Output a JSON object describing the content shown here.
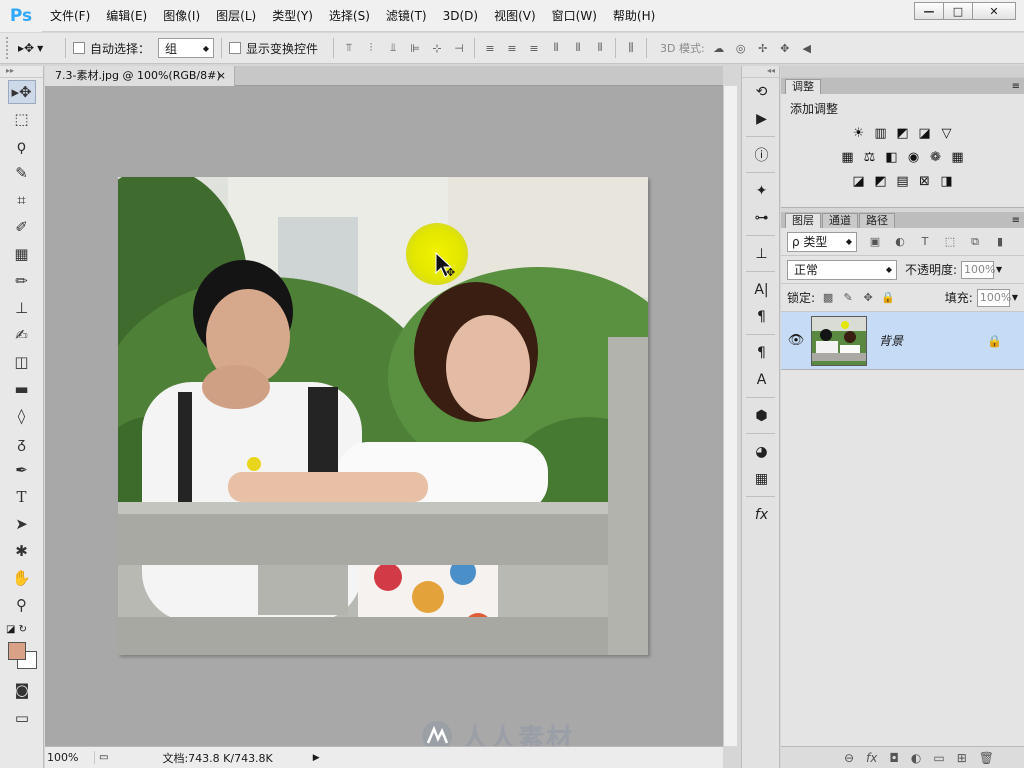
{
  "app": {
    "logo": "Ps"
  },
  "menu": [
    "文件(F)",
    "编辑(E)",
    "图像(I)",
    "图层(L)",
    "类型(Y)",
    "选择(S)",
    "滤镜(T)",
    "3D(D)",
    "视图(V)",
    "窗口(W)",
    "帮助(H)"
  ],
  "window_buttons": {
    "minimize": "—",
    "maximize": "□",
    "close": "✕"
  },
  "options": {
    "auto_select_label": "自动选择：",
    "auto_select_value": "组",
    "show_transform_label": "显示变换控件",
    "mode3d_label": "3D 模式:"
  },
  "document": {
    "tab_title": "7.3-素材.jpg @ 100%(RGB/8#)",
    "tab_close": "×",
    "zoom": "100%",
    "doc_info": "文档:743.8 K/743.8K",
    "status_arrow": "▶"
  },
  "adjustments": {
    "tab": "调整",
    "title": "添加调整",
    "row1": [
      "☀",
      "▥",
      "◩",
      "◪",
      "▽"
    ],
    "row2": [
      "▦",
      "⚖",
      "◧",
      "◉",
      "❁",
      "▦"
    ],
    "row3": [
      "◪",
      "◩",
      "▤",
      "⊠",
      "◨"
    ]
  },
  "layers_panel": {
    "tabs": [
      "图层",
      "通道",
      "路径"
    ],
    "filter_label": "ρ 类型",
    "blend_mode": "正常",
    "opacity_label": "不透明度:",
    "opacity_value": "100%",
    "lock_label": "锁定:",
    "fill_label": "填充:",
    "fill_value": "100%",
    "layer_name": "背景",
    "footer_icons": [
      "⊖",
      "fx",
      "◘",
      "◐",
      "▭",
      "⊞",
      "🗑"
    ]
  },
  "watermark": {
    "text": "人人素材"
  },
  "colors": {
    "foreground": "#d9a287",
    "background": "#ffffff",
    "selected_layer": "#c6dbf5",
    "ps_blue": "#31a8ff"
  }
}
